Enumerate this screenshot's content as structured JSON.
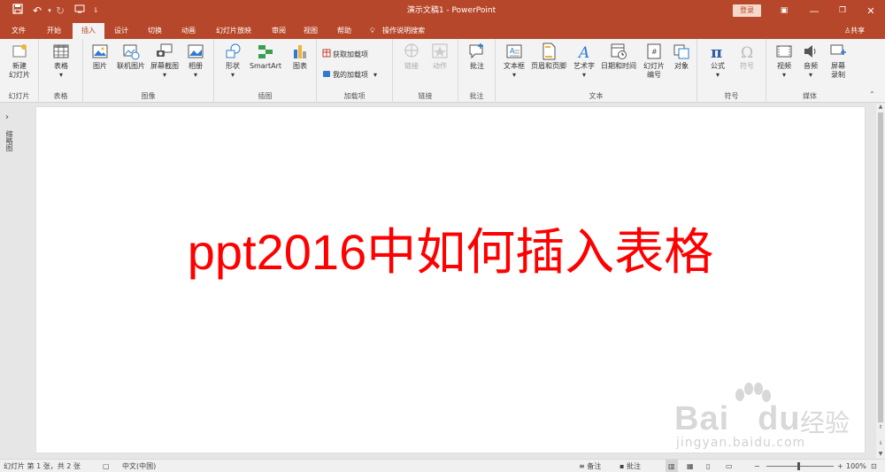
{
  "app": {
    "title": "演示文稿1  -  PowerPoint",
    "login_label": "登录",
    "accent_color": "#b7472a"
  },
  "qat": {
    "save_icon": "save-icon",
    "undo_icon": "undo-icon",
    "redo_icon": "redo-icon",
    "start_icon": "start-from-beginning-icon"
  },
  "window": {
    "restore_ribbon_icon": "ribbon-display-icon",
    "minimize_icon": "minimize-icon",
    "maximize_icon": "maximize-icon",
    "close_icon": "close-icon"
  },
  "tabs": [
    {
      "label": "文件"
    },
    {
      "label": "开始"
    },
    {
      "label": "插入",
      "active": true
    },
    {
      "label": "设计"
    },
    {
      "label": "切换"
    },
    {
      "label": "动画"
    },
    {
      "label": "幻灯片放映"
    },
    {
      "label": "审阅"
    },
    {
      "label": "视图"
    },
    {
      "label": "帮助"
    }
  ],
  "tell_me": "操作说明搜索",
  "share_label": "共享",
  "ribbon": {
    "groups": {
      "slides": "幻灯片",
      "tables": "表格",
      "images": "图像",
      "illustrations": "插图",
      "addins": "加载项",
      "links": "链接",
      "comments": "批注",
      "text": "文本",
      "symbols": "符号",
      "media": "媒体"
    },
    "buttons": {
      "new_slide_1": "新建",
      "new_slide_2": "幻灯片",
      "table": "表格",
      "picture": "图片",
      "online_picture": "联机图片",
      "screenshot": "屏幕截图",
      "album": "相册",
      "shapes": "形状",
      "smartart": "SmartArt",
      "chart": "图表",
      "get_addins": "获取加载项",
      "my_addins": "我的加载项",
      "link": "链接",
      "action": "动作",
      "comment": "批注",
      "textbox": "文本框",
      "header_footer": "页眉和页脚",
      "wordart": "艺术字",
      "datetime": "日期和时间",
      "slide_number_1": "幻灯片",
      "slide_number_2": "编号",
      "object": "对象",
      "equation": "公式",
      "symbol": "符号",
      "video": "视频",
      "audio": "音频",
      "screen_record_1": "屏幕",
      "screen_record_2": "录制"
    }
  },
  "thumb_pane_label": "缩略图",
  "slide": {
    "title": "ppt2016中如何插入表格",
    "title_color": "#ff0000"
  },
  "watermark": {
    "brand": "Bai",
    "brand2": "du",
    "cn": "经验",
    "url": "jingyan.baidu.com"
  },
  "status": {
    "slide_info": "幻灯片 第 1 张，共 2 张",
    "language": "中文(中国)",
    "notes": "备注",
    "comments": "批注",
    "zoom": "100%"
  }
}
